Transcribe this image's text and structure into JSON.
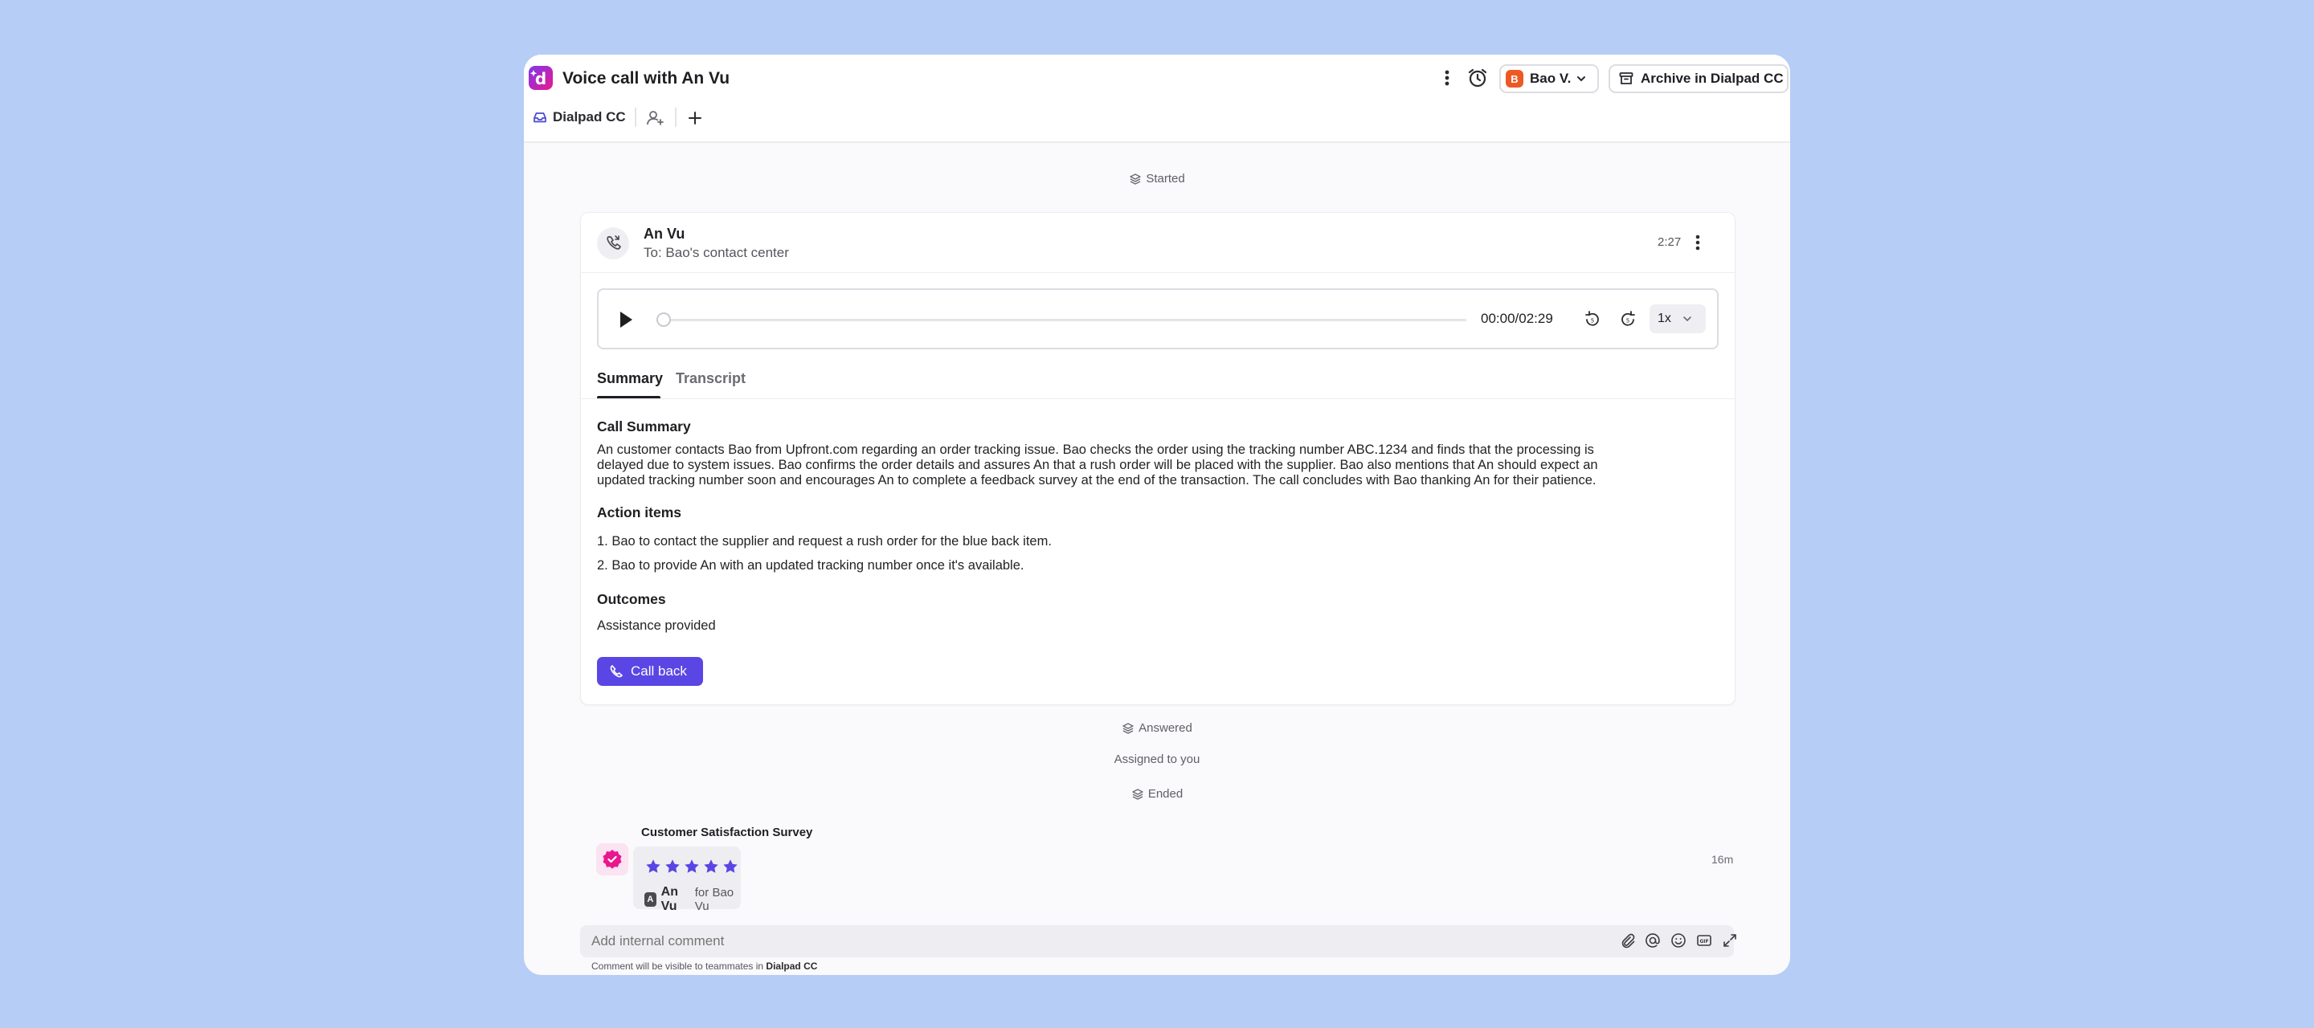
{
  "header": {
    "title": "Voice call with An Vu",
    "assignee_initial": "B",
    "assignee_name": "Bao V.",
    "archive_label": "Archive in Dialpad CC",
    "tabs": [
      {
        "label": "Dialpad CC"
      }
    ]
  },
  "timeline": {
    "started": "Started",
    "answered": "Answered",
    "assigned": "Assigned to you",
    "ended": "Ended"
  },
  "call": {
    "caller": "An Vu",
    "to": "To: Bao's contact center",
    "duration": "2:27",
    "player_time": "00:00/02:29",
    "speed": "1x",
    "progress": 0
  },
  "tabs": {
    "summary": "Summary",
    "transcript": "Transcript",
    "active": "summary"
  },
  "summary": {
    "heading": "Call Summary",
    "lines": [
      "An customer contacts Bao from Upfront.com regarding an order tracking issue. Bao checks the order using the tracking number ABC.1234 and finds that the processing is",
      "delayed due to system issues. Bao confirms the order details and assures An that a rush order will be placed with the supplier. Bao also mentions that An should expect an",
      "updated tracking number soon and encourages An to complete a feedback survey at the end of the transaction. The call concludes with Bao thanking An for their patience."
    ],
    "action_heading": "Action items",
    "actions": [
      "1. Bao to contact the supplier and request a rush order for the blue back item.",
      "2. Bao to provide An with an updated tracking number once it's available."
    ],
    "outcomes_heading": "Outcomes",
    "outcome": "Assistance provided",
    "callback_label": "Call back"
  },
  "survey": {
    "title": "Customer Satisfaction Survey",
    "rating": 5,
    "max_rating": 5,
    "responder_initial": "A",
    "responder": "An Vu",
    "for_text": "for Bao Vu",
    "time": "16m"
  },
  "comment": {
    "placeholder": "Add internal comment",
    "note_prefix": "Comment will be visible to teammates in",
    "note_team": "Dialpad CC"
  },
  "colors": {
    "accent": "#5a46e4",
    "brand": "#e9178e",
    "avatar": "#ec5a24",
    "star": "#5a46e4"
  },
  "icons": [
    "dialpad-logo-icon",
    "kebab-icon",
    "alarm-icon",
    "chevron-down-icon",
    "archive-icon",
    "inbox-icon",
    "add-user-icon",
    "plus-icon",
    "layers-icon",
    "phone-icon",
    "play-icon",
    "rewind-icon",
    "forward-icon",
    "star-icon",
    "badge-check-icon",
    "paperclip-icon",
    "at-icon",
    "emoji-icon",
    "gif-icon",
    "expand-icon"
  ]
}
